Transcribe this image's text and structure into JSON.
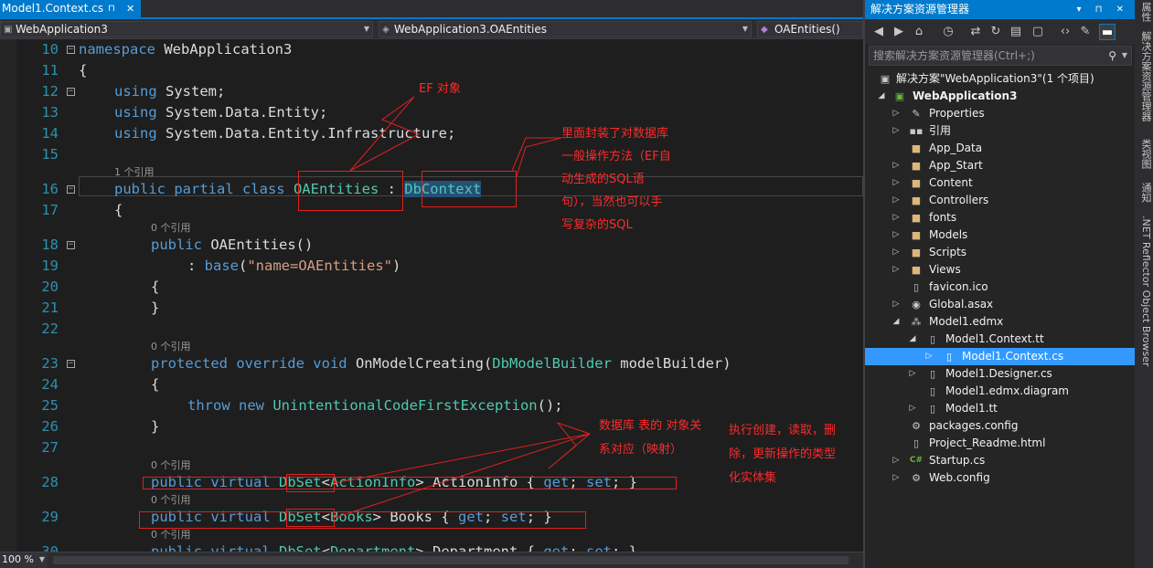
{
  "editor": {
    "tab": {
      "title": "Model1.Context.cs",
      "pin": "⊓",
      "close": "✕"
    },
    "nav": {
      "project": "WebApplication3",
      "class": "WebApplication3.OAEntities",
      "member": "OAEntities()"
    },
    "lines": [
      "10",
      "11",
      "12",
      "13",
      "14",
      "15",
      "16",
      "17",
      "18",
      "19",
      "20",
      "21",
      "22",
      "23",
      "24",
      "25",
      "26",
      "27",
      "28",
      "29",
      "30"
    ],
    "refs": {
      "one": "1 个引用",
      "zero": "0 个引用"
    },
    "code": {
      "namespace_kw": "namespace",
      "namespace_name": " WebApplication3",
      "open_brace": "{",
      "close_brace": "}",
      "using_kw": "using",
      "using1": " System;",
      "using2": " System.Data.Entity;",
      "using3": " System.Data.Entity.Infrastructure;",
      "class_kw": "public partial class ",
      "class_name": "OAEntities",
      "colon": " : ",
      "base_name": "DbContext",
      "ctor_kw": "public ",
      "ctor_name": "OAEntities()",
      "base_call_prefix": ": ",
      "base_kw": "base",
      "base_arg_open": "(",
      "base_arg": "\"name=OAEntities\"",
      "base_arg_close": ")",
      "override_kw": "protected override void ",
      "method_name": "OnModelCreating(",
      "param_type": "DbModelBuilder",
      "param_name": " modelBuilder)",
      "throw_kw": "throw new ",
      "exc_type": "UnintentionalCodeFirstException",
      "exc_tail": "();",
      "prop_kw": "public virtual ",
      "dbset": "DbSet",
      "lt": "<",
      "gt": ">",
      "prop1_type": "ActionInfo",
      "prop1_name": " ActionInfo { ",
      "prop2_type": "Books",
      "prop2_name": " Books { ",
      "prop3_type": "Department",
      "prop3_name": " Department { ",
      "get_kw": "get",
      "set_kw": "set",
      "semi": "; ",
      "semi_close": "; }"
    },
    "annotations": {
      "ef": "EF 对象",
      "dbcontext_1": "里面封装了对数据库",
      "dbcontext_2": "一般操作方法（EF自",
      "dbcontext_3": "动生成的SQL语",
      "dbcontext_4": "句），当然也可以手",
      "dbcontext_5": "写复杂的SQL",
      "mapping_1": "数据库 表的 对象关",
      "mapping_2": "系对应（映射）",
      "crud_1": "执行创建，读取，删",
      "crud_2": "除，更新操作的类型",
      "crud_3": "化实体集"
    },
    "zoom": "100 %"
  },
  "solution_explorer": {
    "title": "解决方案资源管理器",
    "title_buttons": "▾ ⊓ ✕",
    "search_placeholder": "搜索解决方案资源管理器(Ctrl+;)",
    "tree": [
      {
        "label": "解决方案\"WebApplication3\"(1 个项目)",
        "icon": "solution-icon"
      },
      {
        "label": "WebApplication3",
        "icon": "csharp-project-icon"
      },
      {
        "label": "Properties",
        "icon": "wrench-icon"
      },
      {
        "label": "引用",
        "icon": "references-icon"
      },
      {
        "label": "App_Data",
        "icon": "folder-icon"
      },
      {
        "label": "App_Start",
        "icon": "folder-icon"
      },
      {
        "label": "Content",
        "icon": "folder-icon"
      },
      {
        "label": "Controllers",
        "icon": "folder-icon"
      },
      {
        "label": "fonts",
        "icon": "folder-icon"
      },
      {
        "label": "Models",
        "icon": "folder-icon"
      },
      {
        "label": "Scripts",
        "icon": "folder-icon"
      },
      {
        "label": "Views",
        "icon": "folder-icon"
      },
      {
        "label": "favicon.ico",
        "icon": "file-icon"
      },
      {
        "label": "Global.asax",
        "icon": "globe-icon"
      },
      {
        "label": "Model1.edmx",
        "icon": "edmx-icon"
      },
      {
        "label": "Model1.Context.tt",
        "icon": "file-icon"
      },
      {
        "label": "Model1.Context.cs",
        "icon": "file-icon"
      },
      {
        "label": "Model1.Designer.cs",
        "icon": "file-icon"
      },
      {
        "label": "Model1.edmx.diagram",
        "icon": "file-icon"
      },
      {
        "label": "Model1.tt",
        "icon": "file-icon"
      },
      {
        "label": "packages.config",
        "icon": "config-icon"
      },
      {
        "label": "Project_Readme.html",
        "icon": "file-icon"
      },
      {
        "label": "Startup.cs",
        "icon": "csharp-file-icon"
      },
      {
        "label": "Web.config",
        "icon": "config-icon"
      }
    ]
  },
  "side_rail": [
    "属性",
    "解决方案资源管理器",
    "类视图",
    "通知",
    ".NET Reflector Object Browser"
  ],
  "colors": {
    "accent": "#007acc",
    "editor_bg": "#1e1e1e",
    "keyword": "#569cd6",
    "type": "#4ec9b0",
    "string": "#d69d85",
    "line_number": "#2b91af",
    "annotation": "#ff2a2a",
    "selection": "#3399ff"
  }
}
